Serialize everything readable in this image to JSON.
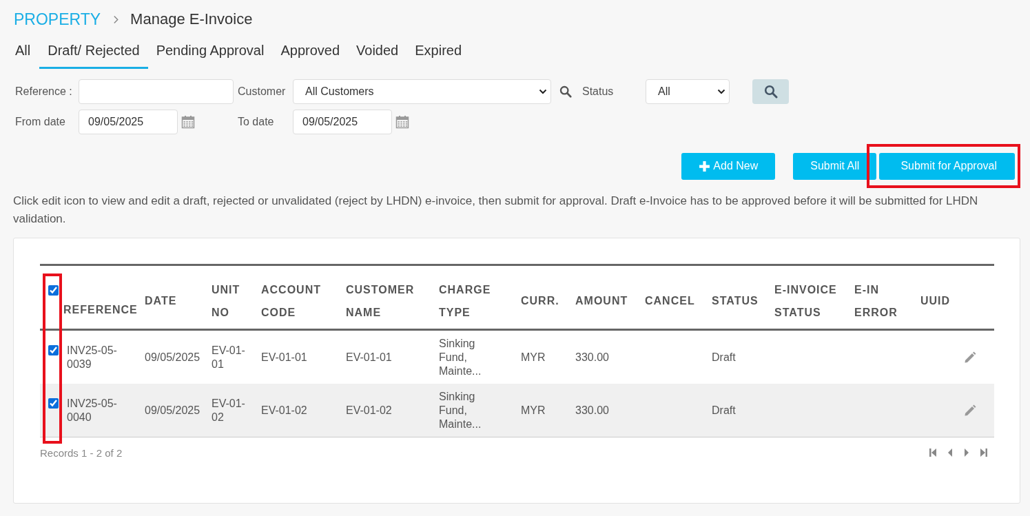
{
  "breadcrumb": {
    "root": "PROPERTY",
    "current": "Manage E-Invoice"
  },
  "tabs": [
    {
      "label": "All",
      "selected": false
    },
    {
      "label": "Draft/ Rejected",
      "selected": true
    },
    {
      "label": "Pending Approval",
      "selected": false
    },
    {
      "label": "Approved",
      "selected": false
    },
    {
      "label": "Voided",
      "selected": false
    },
    {
      "label": "Expired",
      "selected": false
    }
  ],
  "filters": {
    "reference": {
      "label": "Reference :"
    },
    "customer": {
      "label": "Customer",
      "value": "All Customers"
    },
    "status": {
      "label": "Status",
      "value": "All"
    },
    "from_date": {
      "label": "From date",
      "value": "09/05/2025"
    },
    "to_date": {
      "label": "To date",
      "value": "09/05/2025"
    }
  },
  "buttons": [
    {
      "label": "Add New",
      "kind": "add",
      "highlighted": false
    },
    {
      "label": "Submit All",
      "kind": "plain",
      "highlighted": false
    },
    {
      "label": "Submit for Approval",
      "kind": "plain",
      "highlighted": true
    }
  ],
  "notice": "Click edit icon to view and edit a draft, rejected or unvalidated (reject by LHDN) e-invoice, then submit for approval. Draft e-Invoice has to be approved before it will be submitted for LHDN validation.",
  "table": {
    "select_all_checked": true,
    "checkbox_column_highlighted": true,
    "columns": [
      "REFERENCE",
      "DATE",
      "UNIT NO",
      "ACCOUNT CODE",
      "CUSTOMER NAME",
      "CHARGE TYPE",
      "CURR.",
      "AMOUNT",
      "CANCEL",
      "STATUS",
      "E-INVOICE STATUS",
      "E-IN ERROR",
      "UUID"
    ],
    "rows": [
      {
        "checked": true,
        "reference": "INV25-05-0039",
        "date": "09/05/2025",
        "unit_no": "EV-01-01",
        "account_code": "EV-01-01",
        "customer_name": "EV-01-01",
        "charge_type": "Sinking Fund, Mainte...",
        "currency": "MYR",
        "amount": "330.00",
        "status": "Draft"
      },
      {
        "checked": true,
        "reference": "INV25-05-0040",
        "date": "09/05/2025",
        "unit_no": "EV-01-02",
        "account_code": "EV-01-02",
        "customer_name": "EV-01-02",
        "charge_type": "Sinking Fund, Mainte...",
        "currency": "MYR",
        "amount": "330.00",
        "status": "Draft"
      }
    ]
  },
  "footer": {
    "records": "Records 1 - 2 of 2"
  }
}
